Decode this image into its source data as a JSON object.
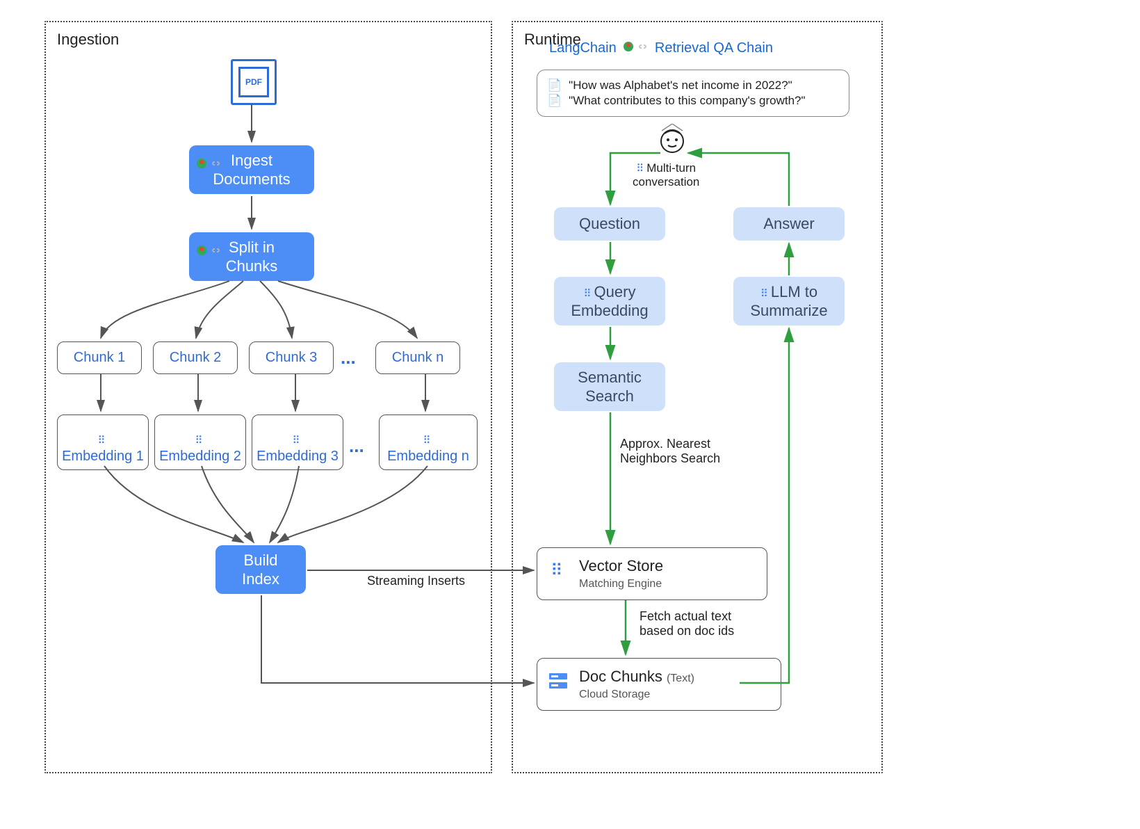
{
  "ingestion": {
    "title": "Ingestion",
    "pdf_label": "PDF",
    "ingest": "Ingest\nDocuments",
    "split": "Split in\nChunks",
    "chunks": [
      "Chunk 1",
      "Chunk 2",
      "Chunk 3",
      "Chunk n"
    ],
    "embeddings": [
      "Embedding 1",
      "Embedding 2",
      "Embedding 3",
      "Embedding n"
    ],
    "ellipsis": "...",
    "build_index": "Build\nIndex",
    "streaming": "Streaming Inserts"
  },
  "runtime": {
    "title": "Runtime",
    "header_left": "LangChain",
    "header_right": "Retrieval QA Chain",
    "speech_1": "\"How was Alphabet's net income in 2022?\"",
    "speech_2": "\"What contributes to this company's growth?\"",
    "multi_turn": "Multi-turn\nconversation",
    "question": "Question",
    "answer": "Answer",
    "query_embedding": "Query\nEmbedding",
    "llm_summarize": "LLM to\nSummarize",
    "semantic_search": "Semantic\nSearch",
    "ann": "Approx. Nearest\nNeighbors Search",
    "vector_store": "Vector Store",
    "vector_store_sub": "Matching Engine",
    "fetch": "Fetch actual text\nbased on doc ids",
    "doc_chunks": "Doc Chunks",
    "doc_chunks_paren": "(Text)",
    "doc_chunks_sub": "Cloud Storage"
  }
}
